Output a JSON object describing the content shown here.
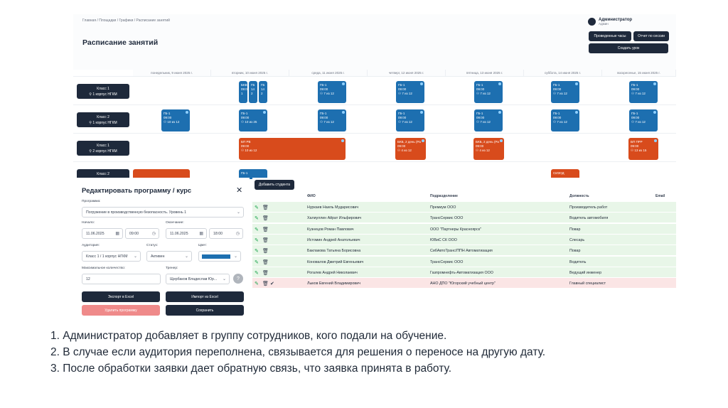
{
  "schedule": {
    "breadcrumb": "Главная / Площадки / Графики / Расписание занятий",
    "title": "Расписание занятий",
    "user": {
      "name": "Администратор",
      "role": "Админ"
    },
    "buttons": [
      "Проведенные часы",
      "Отчет по сессии",
      "Создать урок"
    ],
    "days": [
      "понедельник, 9 июня 2025 г.",
      "вторник, 10 июня 2025 г.",
      "среда, 11 июня 2025 г.",
      "четверг, 12 июня 2025 г.",
      "пятница, 13 июня 2025 г.",
      "суббота, 14 июня 2025 г.",
      "воскресенье, 15 июня 2025 г."
    ],
    "rooms": [
      {
        "name": "Класс 1",
        "loc": "1 корпус НГКМ"
      },
      {
        "name": "Класс 2",
        "loc": "1 корпус НГКМ"
      },
      {
        "name": "Класс 1",
        "loc": "2 корпус НГКМ"
      },
      {
        "name": "Класс 2",
        "loc": ""
      }
    ],
    "events": {
      "r1_tue_a": {
        "t": "БКВ",
        "time": "09:00",
        "n": "1"
      },
      "r1_tue_b": {
        "t": "ГБ",
        "time": "14",
        "n": "2"
      },
      "r1_tue_c": {
        "t": "ГБ",
        "time": "14",
        "n": "2"
      },
      "r1": {
        "t": "ГБ-1",
        "time": "09:00",
        "n": "7 из 12"
      },
      "r2": {
        "t": "ГБ-1",
        "time": "09:00",
        "n": "7 из 12"
      },
      "r2_mon": {
        "t": "ГБ-1",
        "time": "09:00",
        "n": "10 из 12"
      },
      "r2_tue": {
        "t": "ГБ-1",
        "time": "09:00",
        "n": "10 из 25"
      },
      "r3_tue": {
        "t": "БП РВ",
        "time": "09:00",
        "n": "10 из 12"
      },
      "r3_thu": {
        "t": "БКБ, 2 день (Ра",
        "time": "09:00",
        "n": "4 из 12"
      },
      "r3_fri": {
        "t": "БКБ, 2 день (Ра",
        "time": "09:00",
        "n": "4 из 12"
      },
      "r3_sun": {
        "t": "БП ПРР",
        "time": "09:00",
        "n": "13 из 15"
      },
      "r4_tue": {
        "t": "ГБ-1",
        "time": "",
        "n": ""
      },
      "r4_sat": {
        "t": "СИЗОД",
        "time": "",
        "n": ""
      }
    }
  },
  "modal": {
    "title": "Редактировать программу / курс",
    "close": "✕",
    "program_label": "Программа:",
    "program_value": "Погружение в производственную безопасность. Уровень 1",
    "start_label": "Начало:",
    "start_date": "11.06.2025",
    "start_time": "09:00",
    "end_label": "Окончание:",
    "end_date": "11.06.2025",
    "end_time": "18:00",
    "auditorium_label": "Аудитория:",
    "auditorium_value": "Класс 1 / 1 корпус НГКМ",
    "status_label": "Статус:",
    "status_value": "Активен",
    "color_label": "Цвет:",
    "color_value": "#1d6fb0",
    "max_label": "Максимальное количество:",
    "max_value": "12",
    "trainer_label": "Тренер:",
    "trainer_value": "Щербаков Владислав Юр...",
    "export": "Экспорт в Excel",
    "import": "Импорт из Excel",
    "delete": "Удалить программу",
    "save": "Сохранить"
  },
  "students": {
    "add_button": "Добавить студента",
    "columns": [
      "ФИО",
      "Подразделение",
      "Должность",
      "Email"
    ],
    "rows": [
      {
        "name": "Нуркаев Наиль Мударисович",
        "dept": "Премиум ООО",
        "pos": "Производитель работ",
        "bg": "#e8f6e8"
      },
      {
        "name": "Халиуллин Айрат Ильфирович",
        "dept": "ТрансСервис ООО",
        "pos": "Водитель автомобиля",
        "bg": "#e8f6e8"
      },
      {
        "name": "Кузнецов Роман Павлович",
        "dept": "ООО \"Партнеры Красноярск\"",
        "pos": "Повар",
        "bg": "#e8f6e8"
      },
      {
        "name": "Истомин Андрей Анатольевич",
        "dept": "ЮВиС СК ООО",
        "pos": "Слесарь",
        "bg": "#e8f6e8"
      },
      {
        "name": "Баклакова Татьяна Борисовна",
        "dept": "СибАвтоТранс/ППН Автоматизация",
        "pos": "Повар",
        "bg": "#e8f6e8"
      },
      {
        "name": "Коновалов Дмитрий Евгеньевич",
        "dept": "ТрансСервис ООО",
        "pos": "Водитель",
        "bg": "#e8f6e8"
      },
      {
        "name": "Рогалев Андрей Николаевич",
        "dept": "Газпромнефть-Автоматизация ООО",
        "pos": "Ведущий инженер",
        "bg": "#e8f6e8"
      },
      {
        "name": "Лыков Евгений Владимирович",
        "dept": "АНО ДПО \"Югорский учебный центр\"",
        "pos": "Главный специалист",
        "bg": "#fbe5e5"
      }
    ]
  },
  "captions": [
    "1. Администратор добавляет в группу сотрудников, кого подали на обучение.",
    "2. В случае если аудитория переполнена, связывается для решения о переносе на другую дату.",
    "3. После обработки заявки дает обратную связь, что заявка принята в работу."
  ],
  "icons": {
    "pin": "map-pin-icon",
    "people": "people-icon",
    "edit": "pencil-icon",
    "delete": "trash-icon",
    "check": "check-icon",
    "calendar": "calendar-icon",
    "clock": "clock-icon"
  }
}
